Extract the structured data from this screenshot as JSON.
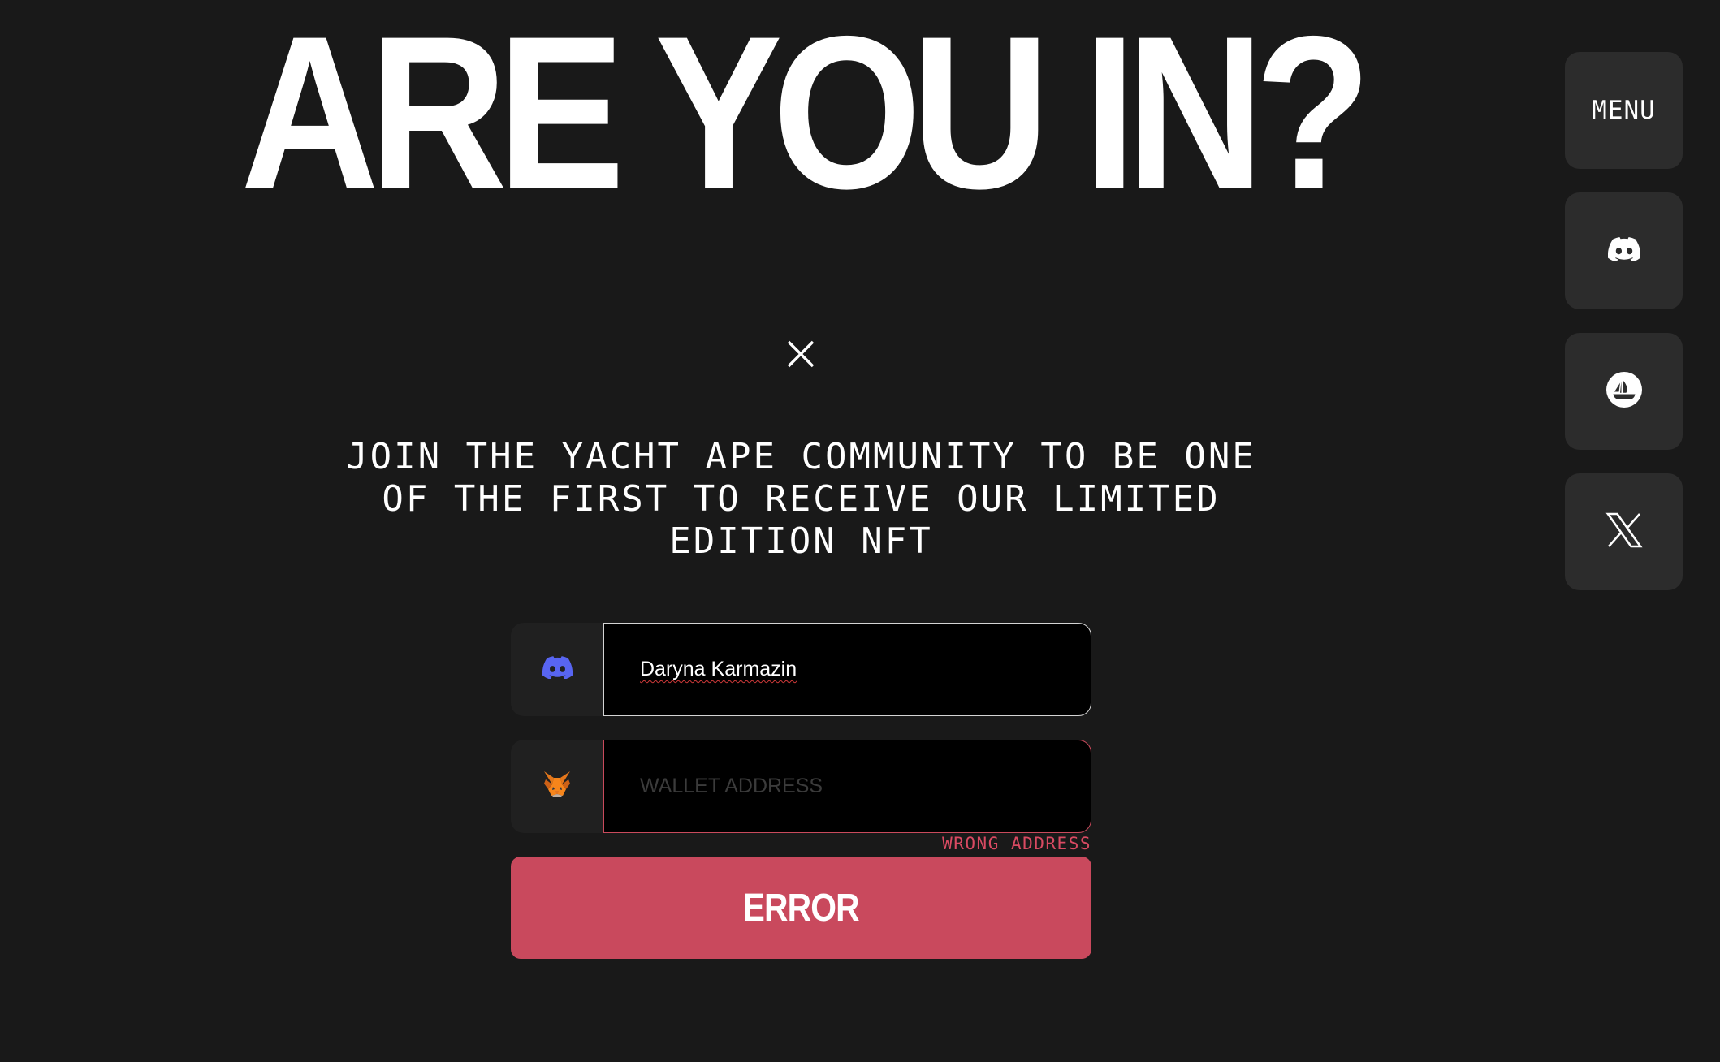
{
  "hero": {
    "title": "ARE YOU IN?"
  },
  "side_nav": {
    "menu_label": "MENU",
    "items": [
      {
        "icon": "discord-icon"
      },
      {
        "icon": "opensea-icon"
      },
      {
        "icon": "x-twitter-icon"
      }
    ]
  },
  "modal": {
    "close_icon": "close-icon",
    "subtitle": "JOIN THE YACHT APE COMMUNITY TO BE ONE OF THE FIRST TO RECEIVE OUR LIMITED EDITION NFT",
    "discord_field": {
      "icon": "discord-icon",
      "value": "Daryna Karmazin"
    },
    "wallet_field": {
      "icon": "metamask-fox-icon",
      "value": "",
      "placeholder": "WALLET ADDRESS"
    },
    "error_message": "WRONG ADDRESS",
    "submit_label": "ERROR"
  },
  "colors": {
    "background": "#191919",
    "side_button": "#2c2c2c",
    "error_accent": "#c9495d",
    "discord_brand": "#5865f2",
    "metamask_orange": "#e2761b"
  }
}
